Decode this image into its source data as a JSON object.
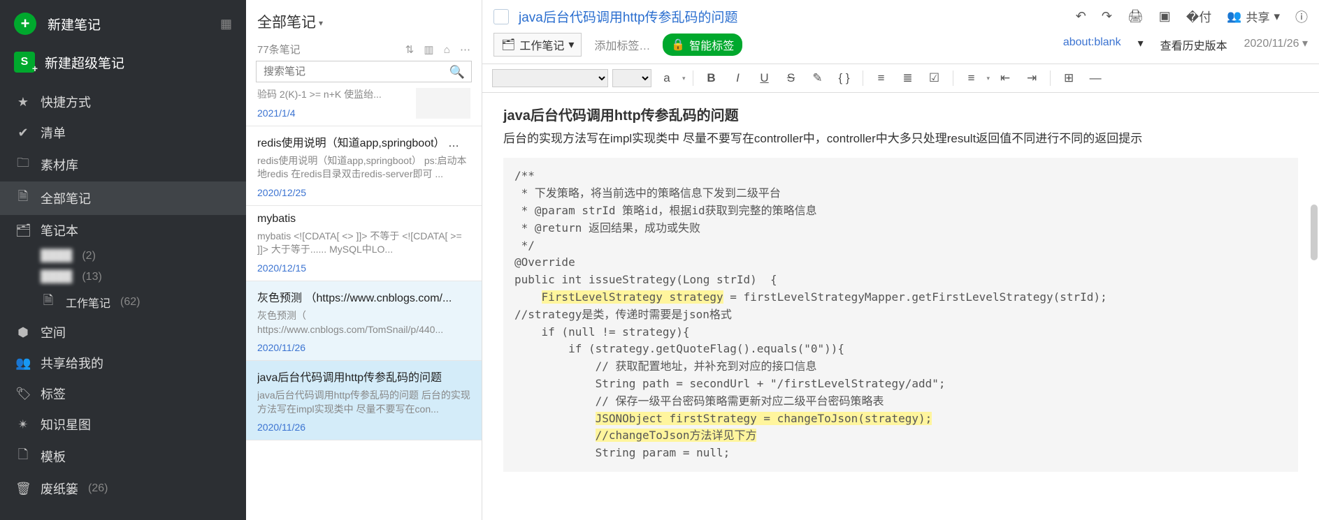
{
  "nav": {
    "newNote": "新建笔记",
    "newSuper": "新建超级笔记",
    "items": [
      {
        "icon": "★",
        "label": "快捷方式"
      },
      {
        "icon": "✔",
        "label": "清单"
      },
      {
        "icon": "🗀",
        "label": "素材库"
      },
      {
        "icon": "🗎",
        "label": "全部笔记",
        "active": true
      },
      {
        "icon": "🗂",
        "label": "笔记本"
      }
    ],
    "subs": [
      {
        "label": "████",
        "count": "(2)"
      },
      {
        "label": "████",
        "count": "(13)"
      },
      {
        "icon": "🗎",
        "label": "工作笔记",
        "count": "(62)"
      }
    ],
    "items2": [
      {
        "icon": "⬢",
        "label": "空间"
      },
      {
        "icon": "👥",
        "label": "共享给我的"
      },
      {
        "icon": "🏷",
        "label": "标签"
      },
      {
        "icon": "✴",
        "label": "知识星图"
      },
      {
        "icon": "🗋",
        "label": "模板"
      },
      {
        "icon": "🗑",
        "label": "废纸篓",
        "count": "(26)"
      }
    ]
  },
  "list": {
    "title": "全部笔记",
    "count": "77条笔记",
    "searchPH": "搜索笔记",
    "items": [
      {
        "partial": true,
        "title": "",
        "snippet": "验码 2(K)-1 >= n+K 使监绐...",
        "date": "2021/1/4",
        "thumb": true
      },
      {
        "title": "redis使用说明（知道app,springboot） …",
        "snippet": "redis使用说明（知道app,springboot） ps:启动本地redis 在redis目录双击redis-server即可 ...",
        "date": "2020/12/25"
      },
      {
        "title": "mybatis",
        "snippet": "mybatis <![CDATA[ <> ]]> 不等于 <![CDATA[ >= ]]> 大于等于...... MySQL中LO...",
        "date": "2020/12/15"
      },
      {
        "title": "灰色预测 （https://www.cnblogs.com/...",
        "snippet": "灰色预测（ https://www.cnblogs.com/TomSnail/p/440...",
        "date": "2020/11/26",
        "sel": 1
      },
      {
        "title": "java后台代码调用http传参乱码的问题",
        "snippet": "java后台代码调用http传参乱码的问题 后台的实现方法写在impl实现类中 尽量不要写在con...",
        "date": "2020/11/26",
        "sel": 2
      }
    ]
  },
  "main": {
    "title": "java后台代码调用http传参乱码的问题",
    "notebookBtn": "工作笔记",
    "addTag": "添加标签…",
    "smart": "智能标签",
    "blank": "about:blank",
    "history": "查看历史版本",
    "date": "2020/11/26",
    "share": "共享",
    "tb": {
      "a": "a",
      "B": "B",
      "I": "I",
      "U": "U",
      "S": "S",
      "brush": "✎",
      "braces": "{ }",
      "ol": "≡",
      "ul": "≣",
      "check": "☑",
      "alignL": "≡",
      "alignC": "≡",
      "indentO": "⇤",
      "indentI": "⇥",
      "table": "⊞",
      "hr": "—"
    },
    "doc": {
      "h": "java后台代码调用http传参乱码的问题",
      "p": "后台的实现方法写在impl实现类中 尽量不要写在controller中，controller中大多只处理result返回值不同进行不同的返回提示",
      "code": {
        "l1": "/**",
        "l2": " * 下发策略，将当前选中的策略信息下发到二级平台",
        "l3": " * @param strId 策略id，根据id获取到完整的策略信息",
        "l4": " * @return 返回结果，成功或失败",
        "l5": " */",
        "l6": "@Override",
        "l7": "public int issueStrategy(Long strId)  {",
        "hl1": "FirstLevelStrategy strategy",
        "l8": " = firstLevelStrategyMapper.getFirstLevelStrategy(strId);",
        "l9": "//strategy是类，传递时需要是json格式",
        "l10": "    if (null != strategy){",
        "l11": "        if (strategy.getQuoteFlag().equals(\"0\")){",
        "l12": "            // 获取配置地址，并补充到对应的接口信息",
        "l13": "            String path = secondUrl + \"/firstLevelStrategy/add\";",
        "l14": "            // 保存一级平台密码策略需更新对应二级平台密码策略表",
        "hl2": "JSONObject firstStrategy = changeToJson(strategy);",
        "hl3a": "//changeToJson",
        "hl3b": "方法详见下方",
        "l15": "            String param = null;"
      }
    }
  }
}
